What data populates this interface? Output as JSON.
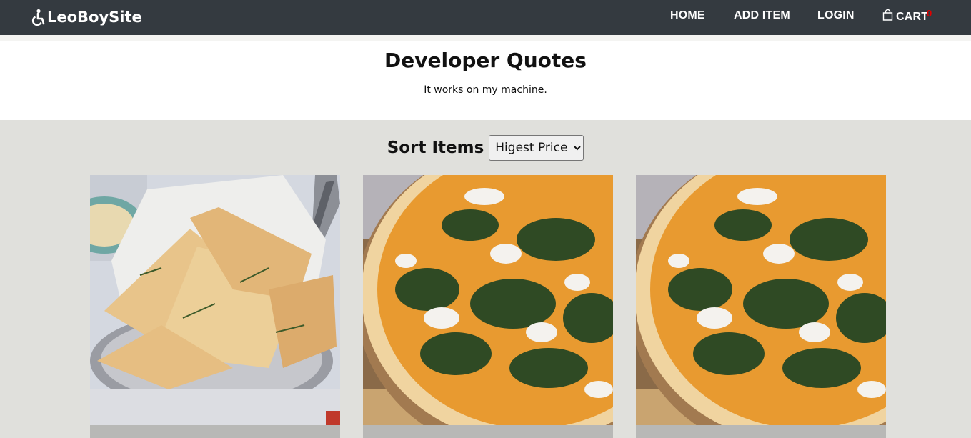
{
  "navbar": {
    "brand": "LeoBoySite",
    "links": {
      "home": "HOME",
      "add_item": "ADD ITEM",
      "login": "LOGIN",
      "cart": "CART"
    },
    "cart_count": "0",
    "colors": {
      "background": "#343a40",
      "badge": "#e00000"
    }
  },
  "quotes": {
    "title": "Developer Quotes",
    "text": "It works on my machine."
  },
  "sort": {
    "label": "Sort Items",
    "selected": "Higest Price"
  },
  "products": [
    {
      "image": "flatbread-basket-image"
    },
    {
      "image": "spinach-pizza-image"
    },
    {
      "image": "spinach-pizza-image"
    }
  ]
}
